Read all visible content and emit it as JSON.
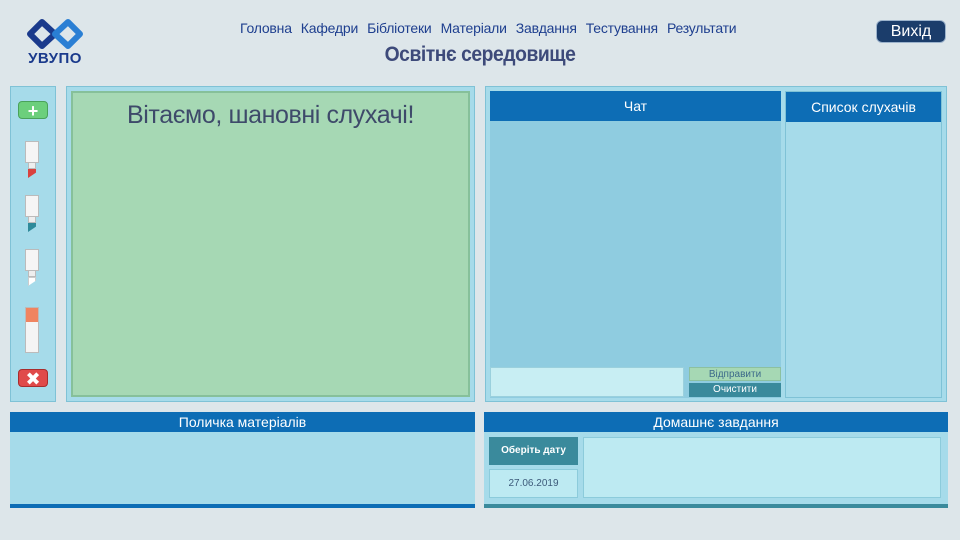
{
  "brand": {
    "logo_text": "УВУПО",
    "logo_color": "#1a3a8c"
  },
  "nav": {
    "items": [
      "Головна",
      "Кафедри",
      "Бібліотеки",
      "Матеріали",
      "Завдання",
      "Тестування",
      "Результати"
    ]
  },
  "page_title": "Освітнє середовище",
  "header": {
    "exit_label": "Вихід"
  },
  "tools": {
    "icons": [
      "add-icon",
      "red-marker-icon",
      "teal-marker-icon",
      "white-marker-icon",
      "eraser-icon",
      "delete-icon"
    ],
    "add_symbol": "+",
    "delete_symbol": "✖",
    "marker_colors": [
      "#d9423f",
      "#2f8a9a",
      "#ffffff"
    ]
  },
  "board": {
    "greeting": "Вітаємо, шановні слухачі!"
  },
  "chat": {
    "title": "Чат",
    "input_value": "",
    "send_label": "Відправити",
    "clear_label": "Очистити"
  },
  "listeners": {
    "title": "Список слухачів",
    "items": []
  },
  "shelf": {
    "title": "Поличка матеріалів"
  },
  "homework": {
    "title": "Домашнє завдання",
    "date_button_label": "Оберіть дату",
    "date_value": "27.06.2019",
    "text_value": ""
  },
  "colors": {
    "accent": "#0d6db5",
    "panel": "#a6dbea",
    "board": "#a6d8b4",
    "exit_button": "#1b3d6b"
  }
}
